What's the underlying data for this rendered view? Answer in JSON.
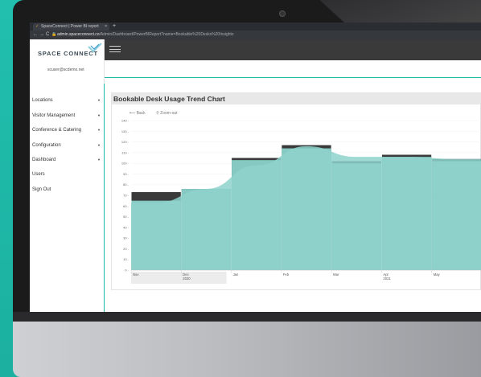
{
  "browser": {
    "tab_title": "SpaceConnect | Power BI report",
    "tab_close": "×",
    "new_tab": "+",
    "back": "←",
    "forward": "→",
    "reload": "C",
    "url_host": "admin.spaceconnect.co",
    "url_path": "/Admin/Dashboard/PowerBIReport?name=Bookable%20Desks%20Insights"
  },
  "app": {
    "logo_text": "SPACE CONNECT",
    "user_email": "scuser@scdemo.net",
    "accent_color": "#1fb8a6"
  },
  "sidebar": {
    "items": [
      {
        "label": "Locations",
        "caret": "▼"
      },
      {
        "label": "Visitor Management",
        "caret": "▼"
      },
      {
        "label": "Conference & Catering",
        "caret": "▼"
      },
      {
        "label": "Configuration",
        "caret": "▼"
      },
      {
        "label": "Dashboard",
        "caret": "▼"
      },
      {
        "label": "Users",
        "caret": ""
      },
      {
        "label": "Sign Out",
        "caret": ""
      }
    ]
  },
  "report": {
    "title": "Bookable Desk Usage Trend Chart",
    "back_label": "Back",
    "zoom_label": "Zoom-out"
  },
  "chart_data": {
    "type": "bar",
    "categories": [
      "Nov",
      "Dec",
      "Jan",
      "Feb",
      "Mar",
      "Apr",
      "May"
    ],
    "year_labels": [
      {
        "label": "2020",
        "under": "Dec"
      },
      {
        "label": "2021",
        "under": "Apr"
      }
    ],
    "series": [
      {
        "values": [
          73,
          76,
          105,
          117,
          102,
          108,
          104
        ],
        "color": "#3a3a3a"
      },
      {
        "values": [
          65,
          76,
          103,
          114,
          100,
          106,
          102
        ],
        "color": "#85c9c2"
      }
    ],
    "trend": [
      63,
      76,
      98,
      116,
      106,
      106,
      104
    ],
    "yticks": [
      0,
      10,
      20,
      30,
      40,
      50,
      60,
      70,
      80,
      90,
      100,
      110,
      120,
      130,
      140
    ],
    "ylim": [
      0,
      140
    ],
    "grid": true
  }
}
